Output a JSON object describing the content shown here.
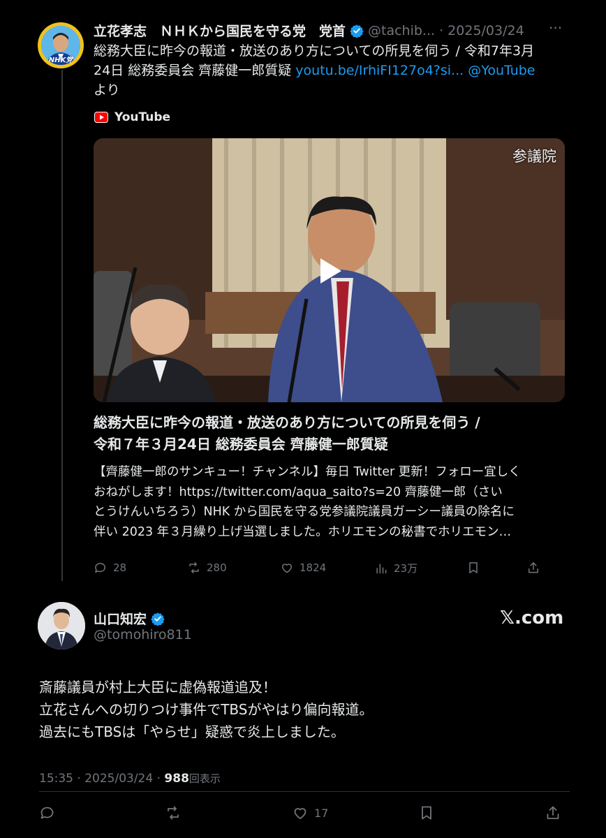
{
  "quoted_post": {
    "author_name": "立花孝志　ＮＨＫから国民を守る党　党首",
    "handle_date": "@tachib... · 2025/03/24",
    "more_label": "···",
    "avatar_label": "NHK党",
    "text_line1": "総務大臣に昨今の報道・放送のあり方についての所見を伺う / 令和7年3月",
    "text_line2_plain": "24日 総務委員会 齊藤健一郎質疑 ",
    "text_link1": "youtu.be/IrhiFI127o4?si...",
    "text_link2": "@YouTube",
    "text_line3": "より",
    "source_label": "YouTube",
    "video_watermark": "参議院",
    "card_title_line1": "総務大臣に昨今の報道・放送のあり方についての所見を伺う /",
    "card_title_line2": "令和７年３月24日 総務委員会 齊藤健一郎質疑",
    "card_desc_line1": "【齊藤健一郎のサンキュー！チャンネル】毎日 Twitter 更新！フォロー宜しく",
    "card_desc_line2": "おねがします！https://twitter.com/aqua_saito?s=20 齊藤健一郎（さい",
    "card_desc_line3": "とうけんいちろう）NHK から国民を守る党参議院議員ガーシー議員の除名に",
    "card_desc_line4": "伴い 2023 年３月繰り上げ当選しました。ホリエモンの秘書でホリエモン…",
    "actions": {
      "replies": "28",
      "reposts": "280",
      "likes": "1824",
      "views": "23万"
    }
  },
  "main_post": {
    "author_name": "山口知宏",
    "handle": "@tomohiro811",
    "brand": "𝕏.com",
    "text_line1": "斎藤議員が村上大臣に虚偽報道追及！",
    "text_line2": "立花さんへの切りつけ事件でTBSがやはり偏向報道。",
    "text_line3": "過去にもTBSは「やらせ」疑惑で炎上しました。",
    "time_date": "15:35 · 2025/03/24 · ",
    "views_count": "988",
    "views_label": "回表示",
    "actions": {
      "likes": "17"
    }
  },
  "colors": {
    "background": "#000000",
    "text": "#e7e9ea",
    "muted": "#71767b",
    "link": "#1d9bf0",
    "verified": "#1d9bf0",
    "youtube_red": "#ff0000"
  }
}
